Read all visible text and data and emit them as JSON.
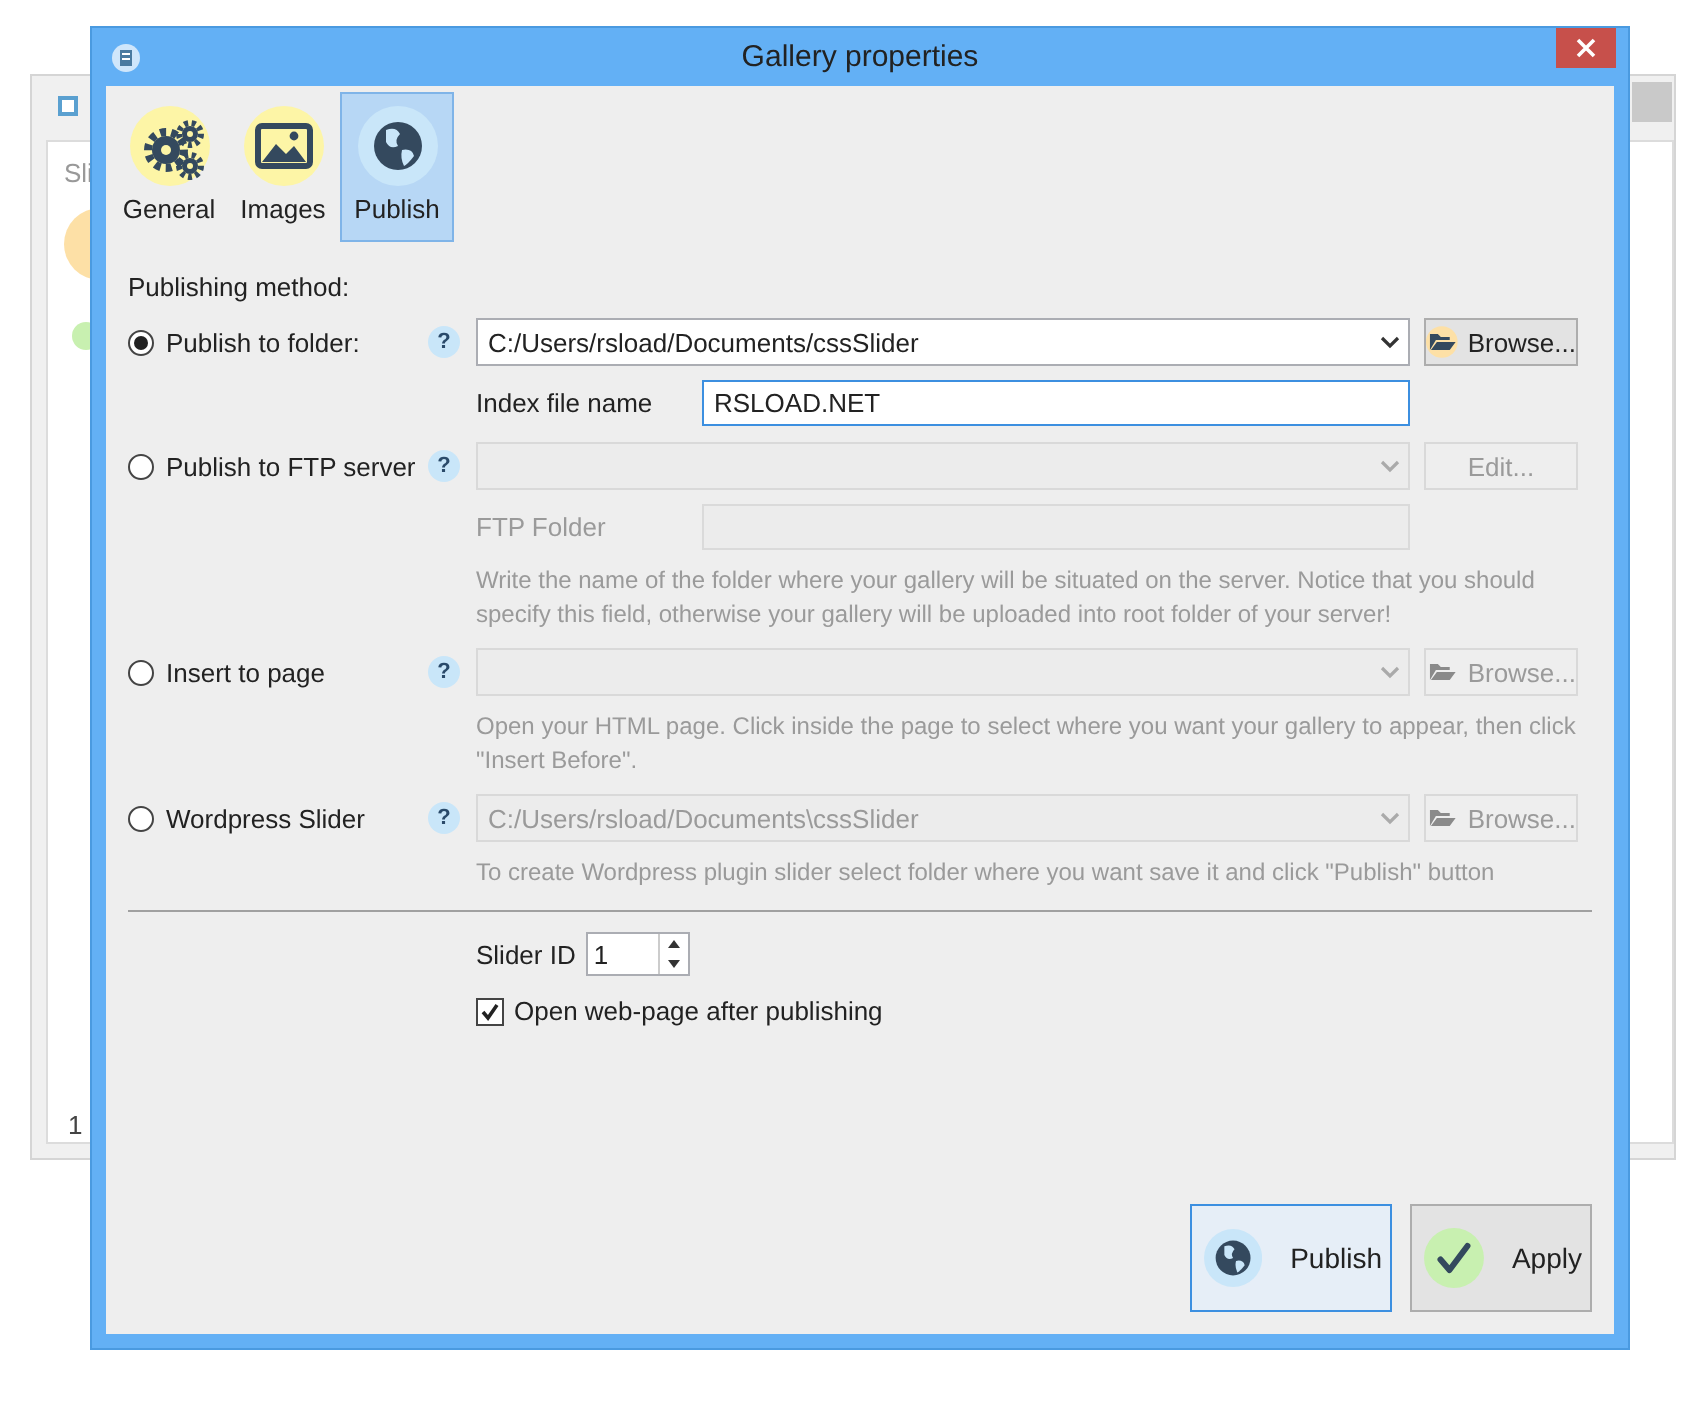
{
  "background_window": {
    "tab_label": "Sli",
    "status_text": "1"
  },
  "dialog": {
    "title": "Gallery properties"
  },
  "tabs": [
    {
      "kind": "gears",
      "label": "General",
      "selected": false
    },
    {
      "kind": "images",
      "label": "Images",
      "selected": false
    },
    {
      "kind": "globe",
      "label": "Publish",
      "selected": true
    }
  ],
  "method_label": "Publishing method:",
  "methods": [
    {
      "label": "Publish to folder:",
      "selected": true,
      "help": "?",
      "field": {
        "value": "C:/Users/rsload/Documents/cssSlider",
        "disabled": false
      },
      "button": {
        "kind": "browse",
        "label": "Browse...",
        "disabled": false
      },
      "subfield": {
        "label": "Index file name",
        "value": "RSLOAD.NET",
        "disabled": false,
        "focused": true
      }
    },
    {
      "label": "Publish to FTP server",
      "selected": false,
      "help": "?",
      "field": {
        "disabled": true
      },
      "button": {
        "kind": "plain",
        "label": "Edit...",
        "disabled": true
      },
      "subfield": {
        "label": "FTP Folder",
        "disabled": true,
        "focused": false
      },
      "note": "Write the name of the folder where your gallery will be situated on the server. Notice that you should specify this field, otherwise your gallery will be uploaded into root folder of your server!"
    },
    {
      "label": "Insert to page",
      "selected": false,
      "help": "?",
      "field": {
        "disabled": true
      },
      "button": {
        "kind": "browse",
        "label": "Browse...",
        "disabled": true
      },
      "note": "Open your HTML page. Click inside the page to select where you want your gallery to appear, then click \"Insert Before\"."
    },
    {
      "label": "Wordpress Slider",
      "selected": false,
      "help": "?",
      "field": {
        "value": "C:/Users/rsload/Documents\\cssSlider",
        "disabled": true
      },
      "button": {
        "kind": "browse",
        "label": "Browse...",
        "disabled": true
      },
      "note": "To create Wordpress plugin slider select folder where you want save it and click \"Publish\" button"
    }
  ],
  "slider_id": {
    "label": "Slider ID",
    "value": "1"
  },
  "open_after": {
    "label": "Open web-page after publishing",
    "checked": true
  },
  "actions": [
    {
      "kind": "publish",
      "label": "Publish",
      "focused": true
    },
    {
      "kind": "apply",
      "label": "Apply",
      "focused": false
    }
  ]
}
